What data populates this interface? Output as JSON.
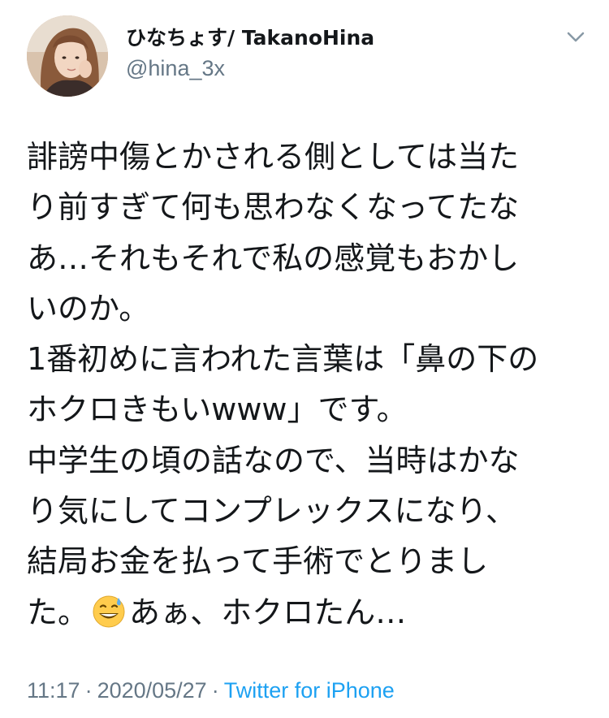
{
  "user": {
    "display_name": "ひなちょす/ TakanoHina",
    "handle": "@hina_3x"
  },
  "icons": {
    "menu": "chevron-down-icon",
    "emoji": "grinning-face-with-sweat"
  },
  "tweet": {
    "lines": [
      "誹謗中傷とかされる側としては当た",
      "り前すぎて何も思わなくなってたな",
      "あ…それもそれで私の感覚もおかし",
      "いのか。",
      "1番初めに言われた言葉は「鼻の下の",
      "ホクロきもいwww」です。",
      "中学生の頃の話なので、当時はかな",
      "り気にしてコンプレックスになり、",
      "結局お金を払って手術でとりまし"
    ],
    "last_line_before_emoji": "た。",
    "last_line_after_emoji": "あぁ、ホクロたん…"
  },
  "meta": {
    "time": "11:17",
    "separator": "·",
    "date": "2020/05/27",
    "source": "Twitter for iPhone"
  },
  "colors": {
    "text": "#14171a",
    "secondary": "#657786",
    "link": "#1da1f2"
  }
}
